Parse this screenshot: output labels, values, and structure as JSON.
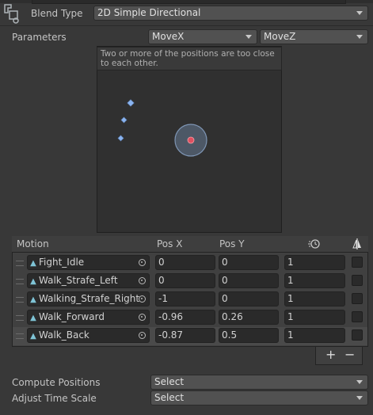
{
  "header": {
    "blend_type_label": "Blend Type",
    "blend_type_value": "2D Simple Directional"
  },
  "parameters": {
    "label": "Parameters",
    "param_x": "MoveX",
    "param_z": "MoveZ"
  },
  "preview": {
    "warning": "Two or more of the positions are too close to each other."
  },
  "table": {
    "columns": {
      "motion": "Motion",
      "pos_x": "Pos X",
      "pos_y": "Pos Y"
    },
    "rows": [
      {
        "motion": "Fight_Idle",
        "pos_x": "0",
        "pos_y": "0",
        "speed": "1"
      },
      {
        "motion": "Walk_Strafe_Left",
        "pos_x": "0",
        "pos_y": "0",
        "speed": "1"
      },
      {
        "motion": "Walking_Strafe_Right",
        "pos_x": "-1",
        "pos_y": "0",
        "speed": "1"
      },
      {
        "motion": "Walk_Forward",
        "pos_x": "-0.96",
        "pos_y": "0.26",
        "speed": "1"
      },
      {
        "motion": "Walk_Back",
        "pos_x": "-0.87",
        "pos_y": "0.5",
        "speed": "1"
      }
    ]
  },
  "footer": {
    "add_label": "+",
    "remove_label": "−",
    "compute_positions_label": "Compute Positions",
    "compute_positions_value": "Select",
    "adjust_time_scale_label": "Adjust Time Scale",
    "adjust_time_scale_value": "Select"
  },
  "icons": {
    "blend_tree_icon": "blend-tree-icon",
    "time_scale_icon": "clock-icon",
    "mirror_icon": "mirror-icon",
    "clip_icon": "animation-clip-icon"
  },
  "colors": {
    "background": "#383838",
    "selected_point": "#e05060",
    "motion_point": "#8ab4f0"
  }
}
